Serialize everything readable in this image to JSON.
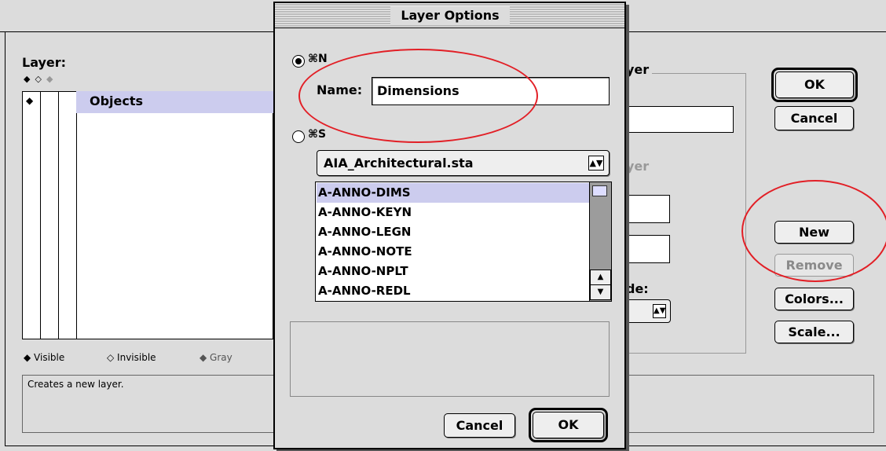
{
  "main_window": {
    "layer_label": "Layer:",
    "visibility_header_icons": [
      "◆",
      "◇",
      "◆"
    ],
    "layers": [
      {
        "visibility": "◆",
        "name": "Objects"
      }
    ],
    "legend": {
      "visible": "◆ Visible",
      "invisible": "◇ Invisible",
      "gray": "◆ Gray"
    },
    "status_text": "Creates a new layer.",
    "partial_labels": {
      "group_title_fragment": "yer",
      "dim_label_fragment": "yer",
      "mode_fragment": "de:"
    },
    "buttons": {
      "ok": "OK",
      "cancel": "Cancel",
      "new": "New",
      "remove": "Remove",
      "colors": "Colors...",
      "scale": "Scale..."
    }
  },
  "dialog": {
    "title": "Layer Options",
    "option_new_label": "⌘N",
    "option_standard_label": "⌘S",
    "name_label": "Name:",
    "name_value": "Dimensions",
    "standard_file": "AIA_Architectural.sta",
    "select_arrows": "▲▼",
    "standard_layers": [
      "A-ANNO-DIMS",
      "A-ANNO-KEYN",
      "A-ANNO-LEGN",
      "A-ANNO-NOTE",
      "A-ANNO-NPLT",
      "A-ANNO-REDL"
    ],
    "scroll_up": "▲",
    "scroll_down": "▼",
    "buttons": {
      "cancel": "Cancel",
      "ok": "OK"
    }
  },
  "colors": {
    "selection_highlight": "#ccccee",
    "annotation_red": "#e21f26",
    "window_gray": "#dcdcdc"
  }
}
